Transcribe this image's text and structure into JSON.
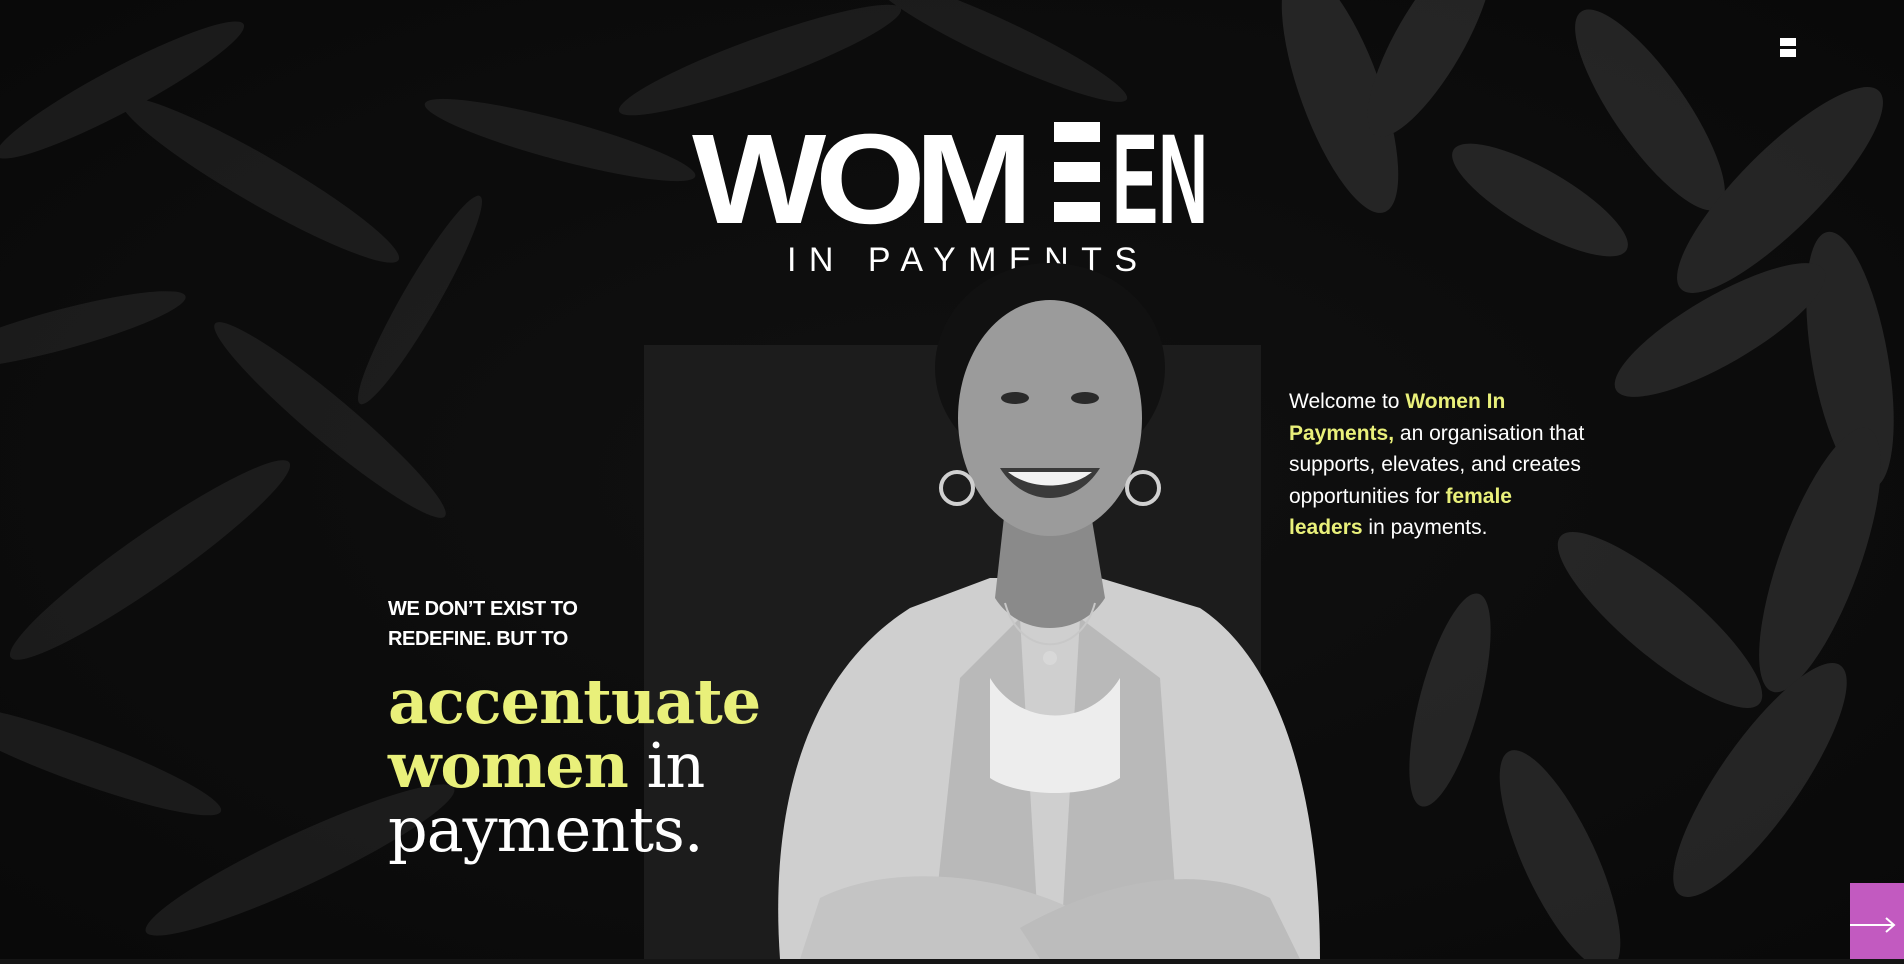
{
  "logo": {
    "word_main": "WOM",
    "word_tail": "EN",
    "subline": "IN PAYMENTS"
  },
  "menu": {
    "icon": "menu-icon"
  },
  "welcome": {
    "p1": "Welcome to ",
    "h1": "Women In Payments,",
    "p2": " an organisation that supports, elevates, and creates opportunities for ",
    "h2": "female leaders",
    "p3": " in payments."
  },
  "hero": {
    "tagline_1": "WE DON’T EXIST TO",
    "tagline_2": "REDEFINE. BUT TO",
    "headline_word1": "accentuate",
    "headline_word2": "women",
    "headline_word3": " in",
    "headline_word4": "payments."
  },
  "next": {
    "icon": "arrow-right-icon"
  },
  "colors": {
    "accent": "#e9f07a",
    "button": "#c25ac0",
    "background": "#151515"
  }
}
